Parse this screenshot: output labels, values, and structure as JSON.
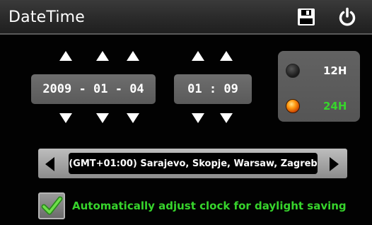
{
  "header": {
    "title": "DateTime",
    "save_icon": "save-icon",
    "power_icon": "power-icon"
  },
  "date": {
    "year": "2009",
    "month": "01",
    "day": "04",
    "separator": " - "
  },
  "time": {
    "hour": "01",
    "minute": "09",
    "separator": " : "
  },
  "clock_mode": {
    "option_12h": "12H",
    "option_24h": "24H",
    "selected": "24H",
    "colors": {
      "inactive_text": "#ffffff",
      "active_text": "#37d42c"
    }
  },
  "timezone": {
    "value": "(GMT+01:00) Sarajevo, Skopje, Warsaw, Zagreb"
  },
  "dst": {
    "checked": true,
    "label": "Automatically adjust clock for daylight saving",
    "color": "#37d42c"
  }
}
